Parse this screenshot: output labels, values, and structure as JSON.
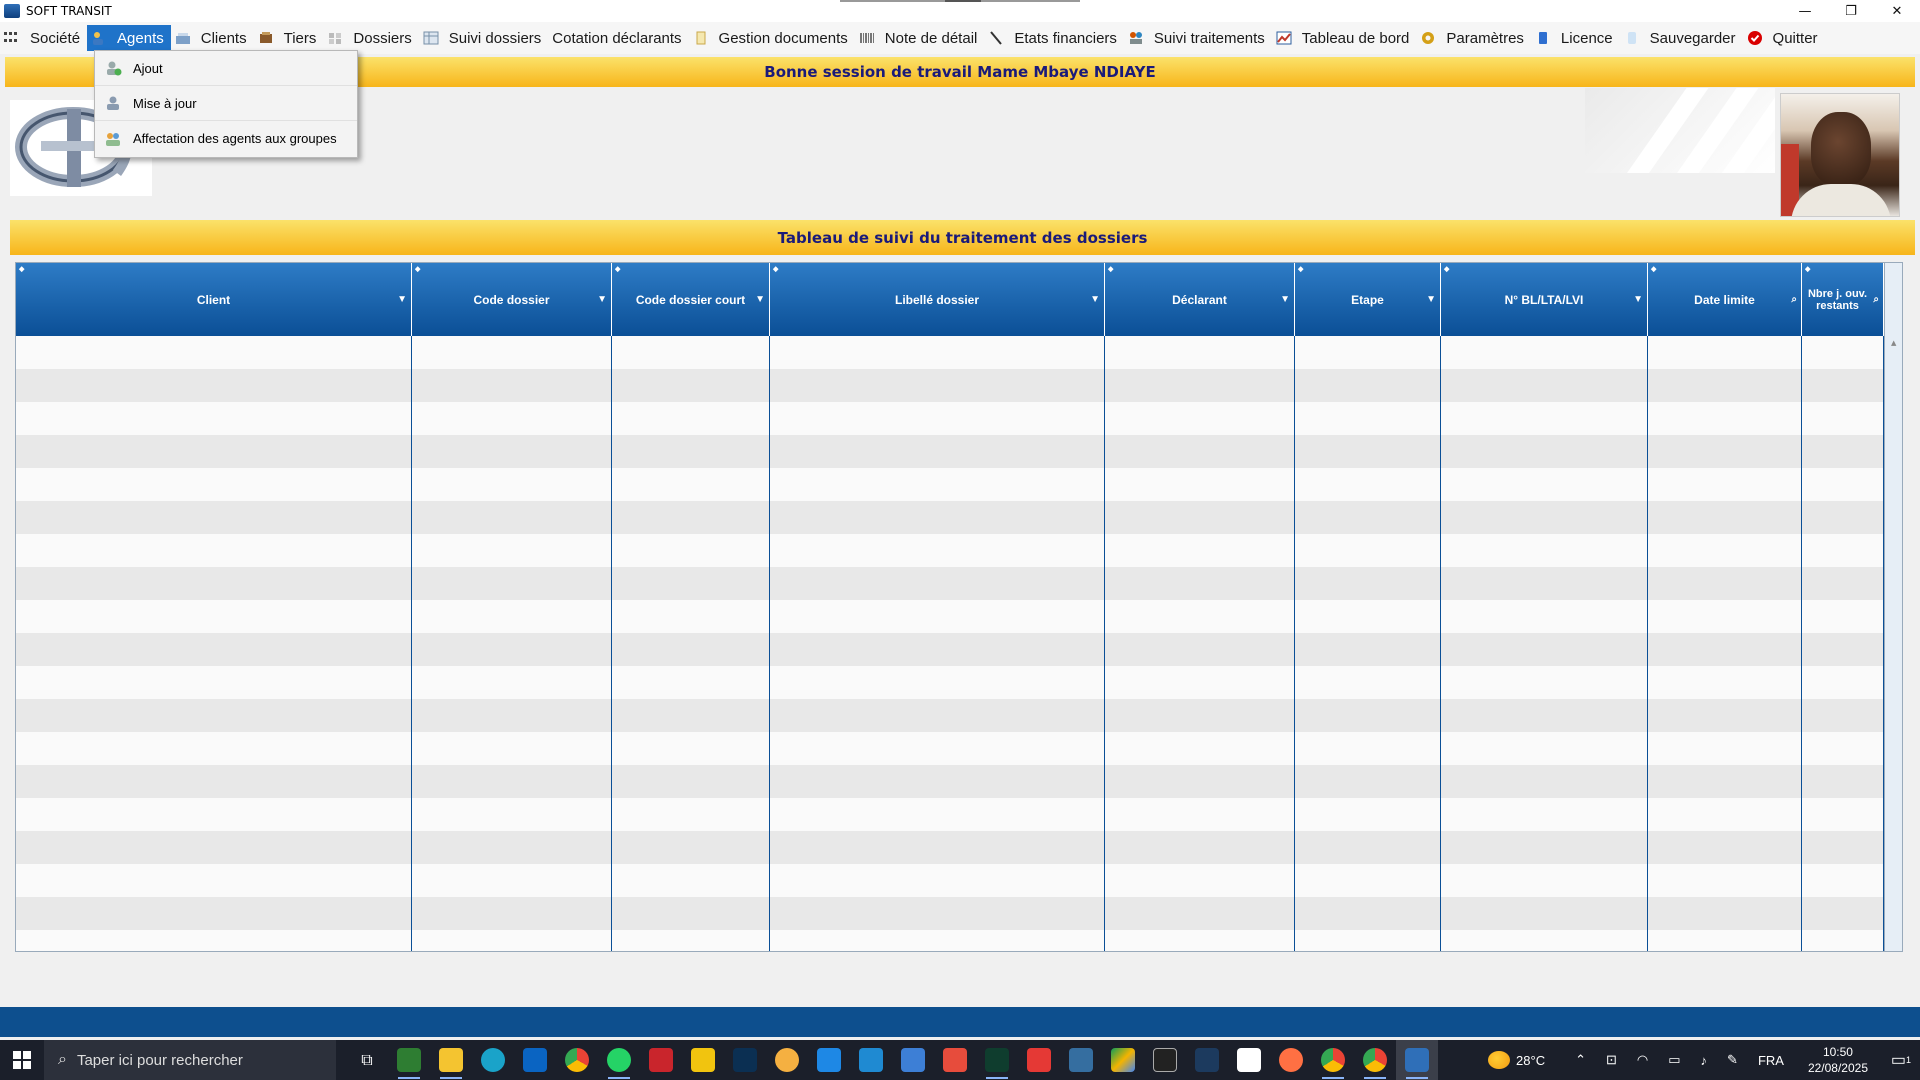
{
  "window": {
    "title": "SOFT TRANSIT",
    "controls": [
      "—",
      "❐",
      "✕"
    ]
  },
  "menubar": {
    "items": [
      {
        "label": "Société",
        "icon": "company-icon"
      },
      {
        "label": "Agents",
        "icon": "agents-icon"
      },
      {
        "label": "Clients",
        "icon": "clients-icon"
      },
      {
        "label": "Tiers",
        "icon": "third-party-icon"
      },
      {
        "label": "Dossiers",
        "icon": "folders-icon"
      },
      {
        "label": "Suivi dossiers",
        "icon": "tracking-icon"
      },
      {
        "label": "Cotation déclarants",
        "icon": ""
      },
      {
        "label": "Gestion documents",
        "icon": "documents-icon"
      },
      {
        "label": "Note de détail",
        "icon": "barcode-icon"
      },
      {
        "label": "Etats financiers",
        "icon": "finance-icon"
      },
      {
        "label": "Suivi traitements",
        "icon": "processing-icon"
      },
      {
        "label": "Tableau de bord",
        "icon": "dashboard-icon"
      },
      {
        "label": "Paramètres",
        "icon": "settings-icon"
      },
      {
        "label": "Licence",
        "icon": "license-icon"
      },
      {
        "label": "Sauvegarder",
        "icon": "save-icon"
      },
      {
        "label": "Quitter",
        "icon": "quit-icon"
      }
    ],
    "active": "Agents"
  },
  "dropdown": {
    "items": [
      {
        "label": "Ajout",
        "icon": "add-agent-icon"
      },
      {
        "label": "Mise à jour",
        "icon": "update-agent-icon"
      },
      {
        "label": "Affectation des agents aux groupes",
        "icon": "assign-group-icon"
      }
    ]
  },
  "banner_session": "Bonne session de travail Mame Mbaye NDIAYE",
  "banner_table": "Tableau de suivi du traitement des dossiers",
  "table": {
    "columns": [
      {
        "label": "Client",
        "icon": "filter"
      },
      {
        "label": "Code dossier",
        "icon": "filter"
      },
      {
        "label": "Code dossier court",
        "icon": "filter"
      },
      {
        "label": "Libellé dossier",
        "icon": "filter"
      },
      {
        "label": "Déclarant",
        "icon": "filter"
      },
      {
        "label": "Etape",
        "icon": "filter"
      },
      {
        "label": "N° BL/LTA/LVI",
        "icon": "filter"
      },
      {
        "label": "Date limite",
        "icon": "search"
      },
      {
        "label": "Nbre j. ouv. restants",
        "icon": "search"
      }
    ],
    "rows": []
  },
  "taskbar": {
    "search_placeholder": "Taper ici pour rechercher",
    "weather": "28°C",
    "language": "FRA",
    "time": "10:50",
    "date": "22/08/2025",
    "notifications": "1"
  },
  "colors": {
    "accent": "#1f73c9",
    "header_blue": "#0b4f96",
    "banner_orange": "#f7b51a",
    "banner_text": "#1a1a7a"
  }
}
